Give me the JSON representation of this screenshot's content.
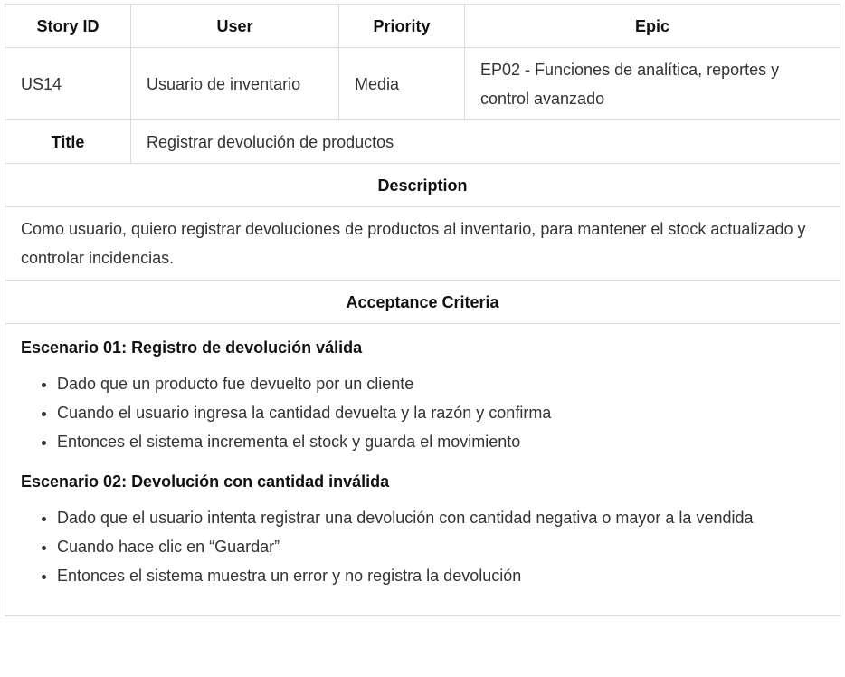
{
  "headers": {
    "story_id": "Story ID",
    "user": "User",
    "priority": "Priority",
    "epic": "Epic"
  },
  "story": {
    "id": "US14",
    "user": "Usuario de inventario",
    "priority": "Media",
    "epic": "EP02 - Funciones de analítica, reportes y control avanzado"
  },
  "title": {
    "label": "Title",
    "value": "Registrar devolución de productos"
  },
  "description": {
    "label": "Description",
    "text": "Como usuario, quiero registrar devoluciones de productos al inventario, para mantener el stock actualizado y controlar incidencias."
  },
  "acceptance": {
    "label": "Acceptance Criteria",
    "scenarios": [
      {
        "title": "Escenario 01: Registro de devolución válida",
        "steps": [
          "Dado que un producto fue devuelto por un cliente",
          "Cuando el usuario ingresa la cantidad devuelta y la razón y confirma",
          "Entonces el sistema incrementa el stock y guarda el movimiento"
        ]
      },
      {
        "title": "Escenario 02: Devolución con cantidad inválida",
        "steps": [
          "Dado que el usuario intenta registrar una devolución con cantidad negativa o mayor a la vendida",
          "Cuando hace clic en “Guardar”",
          "Entonces el sistema muestra un error y no registra la devolución"
        ]
      }
    ]
  }
}
